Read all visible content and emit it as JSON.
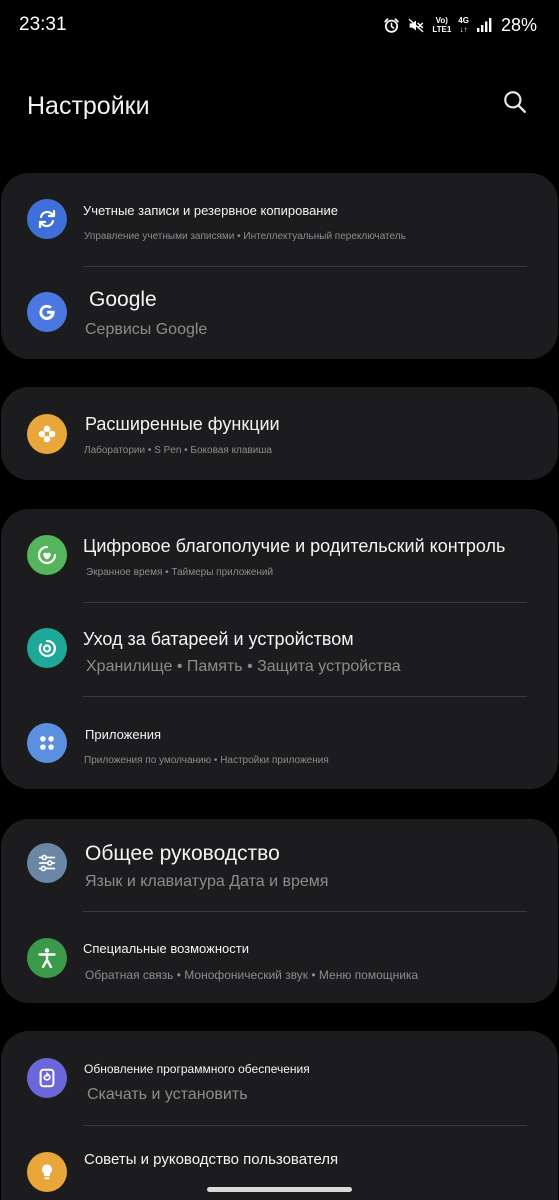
{
  "status_bar": {
    "time": "23:31",
    "net_top": "Vo)",
    "net_bottom": "LTE1",
    "gen": "4G",
    "battery": "28%",
    "icons": [
      "alarm-icon",
      "mute-icon",
      "volte-icon",
      "4g-icon",
      "signal-icon"
    ]
  },
  "header": {
    "title": "Настройки",
    "search_icon": "search-icon"
  },
  "groups": [
    {
      "items": [
        {
          "icon": "sync-icon",
          "color": "#3f6fd8",
          "title": "Учетные записи и резервное копирование",
          "subtitle": "Управление учетными записями • Интеллектуальный переключатель"
        },
        {
          "icon": "google-icon",
          "color": "#4a78e0",
          "title": "Google",
          "subtitle": "Сервисы Google"
        }
      ]
    },
    {
      "items": [
        {
          "icon": "flower-icon",
          "color": "#e9a63a",
          "title": "Расширенные функции",
          "subtitle": "Лаборатории • S Pen • Боковая клавиша"
        }
      ]
    },
    {
      "items": [
        {
          "icon": "wellbeing-icon",
          "color": "#56b45c",
          "title": "Цифровое благополучие и родительский контроль",
          "subtitle": "Экранное время • Таймеры приложений"
        },
        {
          "icon": "battery-care-icon",
          "color": "#1ea897",
          "title": "Уход за батареей и устройством",
          "subtitle": "Хранилище • Память • Защита устройства"
        },
        {
          "icon": "apps-icon",
          "color": "#5b8fe0",
          "title": "Приложения",
          "subtitle": "Приложения по умолчанию • Настройки приложения"
        }
      ]
    },
    {
      "items": [
        {
          "icon": "sliders-icon",
          "color": "#6c86a6",
          "title": "Общее руководство",
          "subtitle": "Язык и клавиатура Дата и время"
        },
        {
          "icon": "accessibility-icon",
          "color": "#3b9a4a",
          "title": "Специальные возможности",
          "subtitle": "Обратная связь • Монофонический звук • Меню помощника"
        }
      ]
    },
    {
      "items": [
        {
          "icon": "update-icon",
          "color": "#6b66d9",
          "title": "Обновление программного обеспечения",
          "subtitle": "Скачать и установить"
        },
        {
          "icon": "tips-icon",
          "color": "#e9a63a",
          "title": "Советы и руководство пользователя",
          "subtitle": ""
        }
      ]
    }
  ]
}
